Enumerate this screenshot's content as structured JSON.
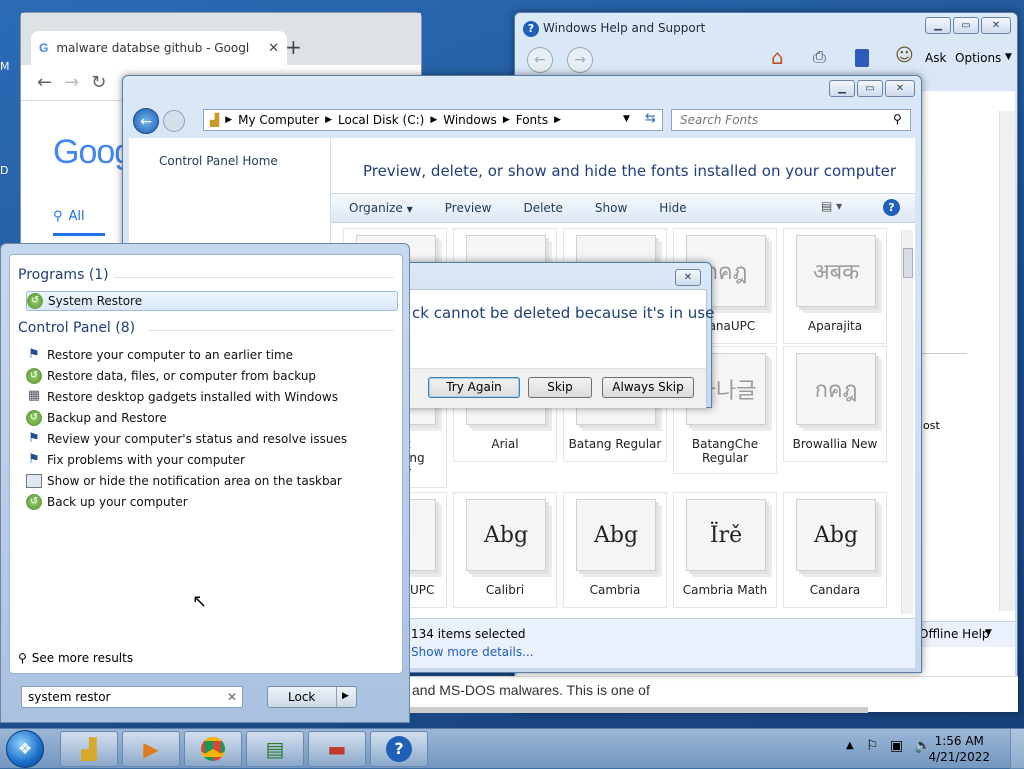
{
  "desktop": {
    "side_letters": [
      "M",
      "D"
    ]
  },
  "chrome": {
    "tab_title": "malware databse github - Googl",
    "search_tab_all": "All",
    "logo_text": "Goog",
    "partial_text": "and MS-DOS malwares. This is one of"
  },
  "help": {
    "title": "Windows Help and Support",
    "ask": "Ask",
    "options": "Options",
    "offline_help": "Offline Help",
    "partial_ost": "ost"
  },
  "explorer": {
    "breadcrumb": [
      "My Computer",
      "Local Disk (C:)",
      "Windows",
      "Fonts"
    ],
    "search_placeholder": "Search Fonts",
    "left_link": "Control Panel Home",
    "heading": "Preview, delete, or show and hide the fonts installed on your computer",
    "commands": [
      "Organize",
      "Preview",
      "Delete",
      "Show",
      "Hide"
    ],
    "fonts_row1": [
      {
        "sample": "",
        "label": ""
      },
      {
        "sample": "",
        "label": ""
      },
      {
        "sample": "",
        "label": ""
      },
      {
        "sample": "กคฎ",
        "label": "gsanaUPC"
      },
      {
        "sample": "अबक",
        "label": "Aparajita"
      }
    ],
    "fonts_row2": [
      {
        "sample": "",
        "label": "t\ning\nr"
      },
      {
        "sample": "Abg",
        "label": "Arial"
      },
      {
        "sample": "",
        "label": "Batang Regular"
      },
      {
        "sample": "가나글",
        "label": "BatangChe\nRegular"
      },
      {
        "sample": "กคฎ",
        "label": "Browallia New"
      }
    ],
    "fonts_row3": [
      {
        "sample": "",
        "label": "UPC"
      },
      {
        "sample": "Abg",
        "label": "Calibri"
      },
      {
        "sample": "Abg",
        "label": "Cambria"
      },
      {
        "sample": "Ïrě",
        "label": "Cambria Math"
      },
      {
        "sample": "Abg",
        "label": "Candara"
      }
    ],
    "status_count": "134 items selected",
    "status_more": "Show more details..."
  },
  "dialog": {
    "message": "ck cannot be deleted because it's in use",
    "try_again": "Try Again",
    "skip": "Skip",
    "always_skip": "Always Skip"
  },
  "startmenu": {
    "programs_header": "Programs (1)",
    "programs": [
      "System Restore"
    ],
    "cp_header": "Control Panel (8)",
    "cp_items": [
      "Restore your computer to an earlier time",
      "Restore data, files, or computer from backup",
      "Restore desktop gadgets installed with Windows",
      "Backup and Restore",
      "Review your computer's status and resolve issues",
      "Fix problems with your computer",
      "Show or hide the notification area on the taskbar",
      "Back up your computer"
    ],
    "see_more": "See more results",
    "search_value": "system restor",
    "lock_label": "Lock"
  },
  "taskbar": {
    "time": "1:56 AM",
    "date": "4/21/2022"
  }
}
